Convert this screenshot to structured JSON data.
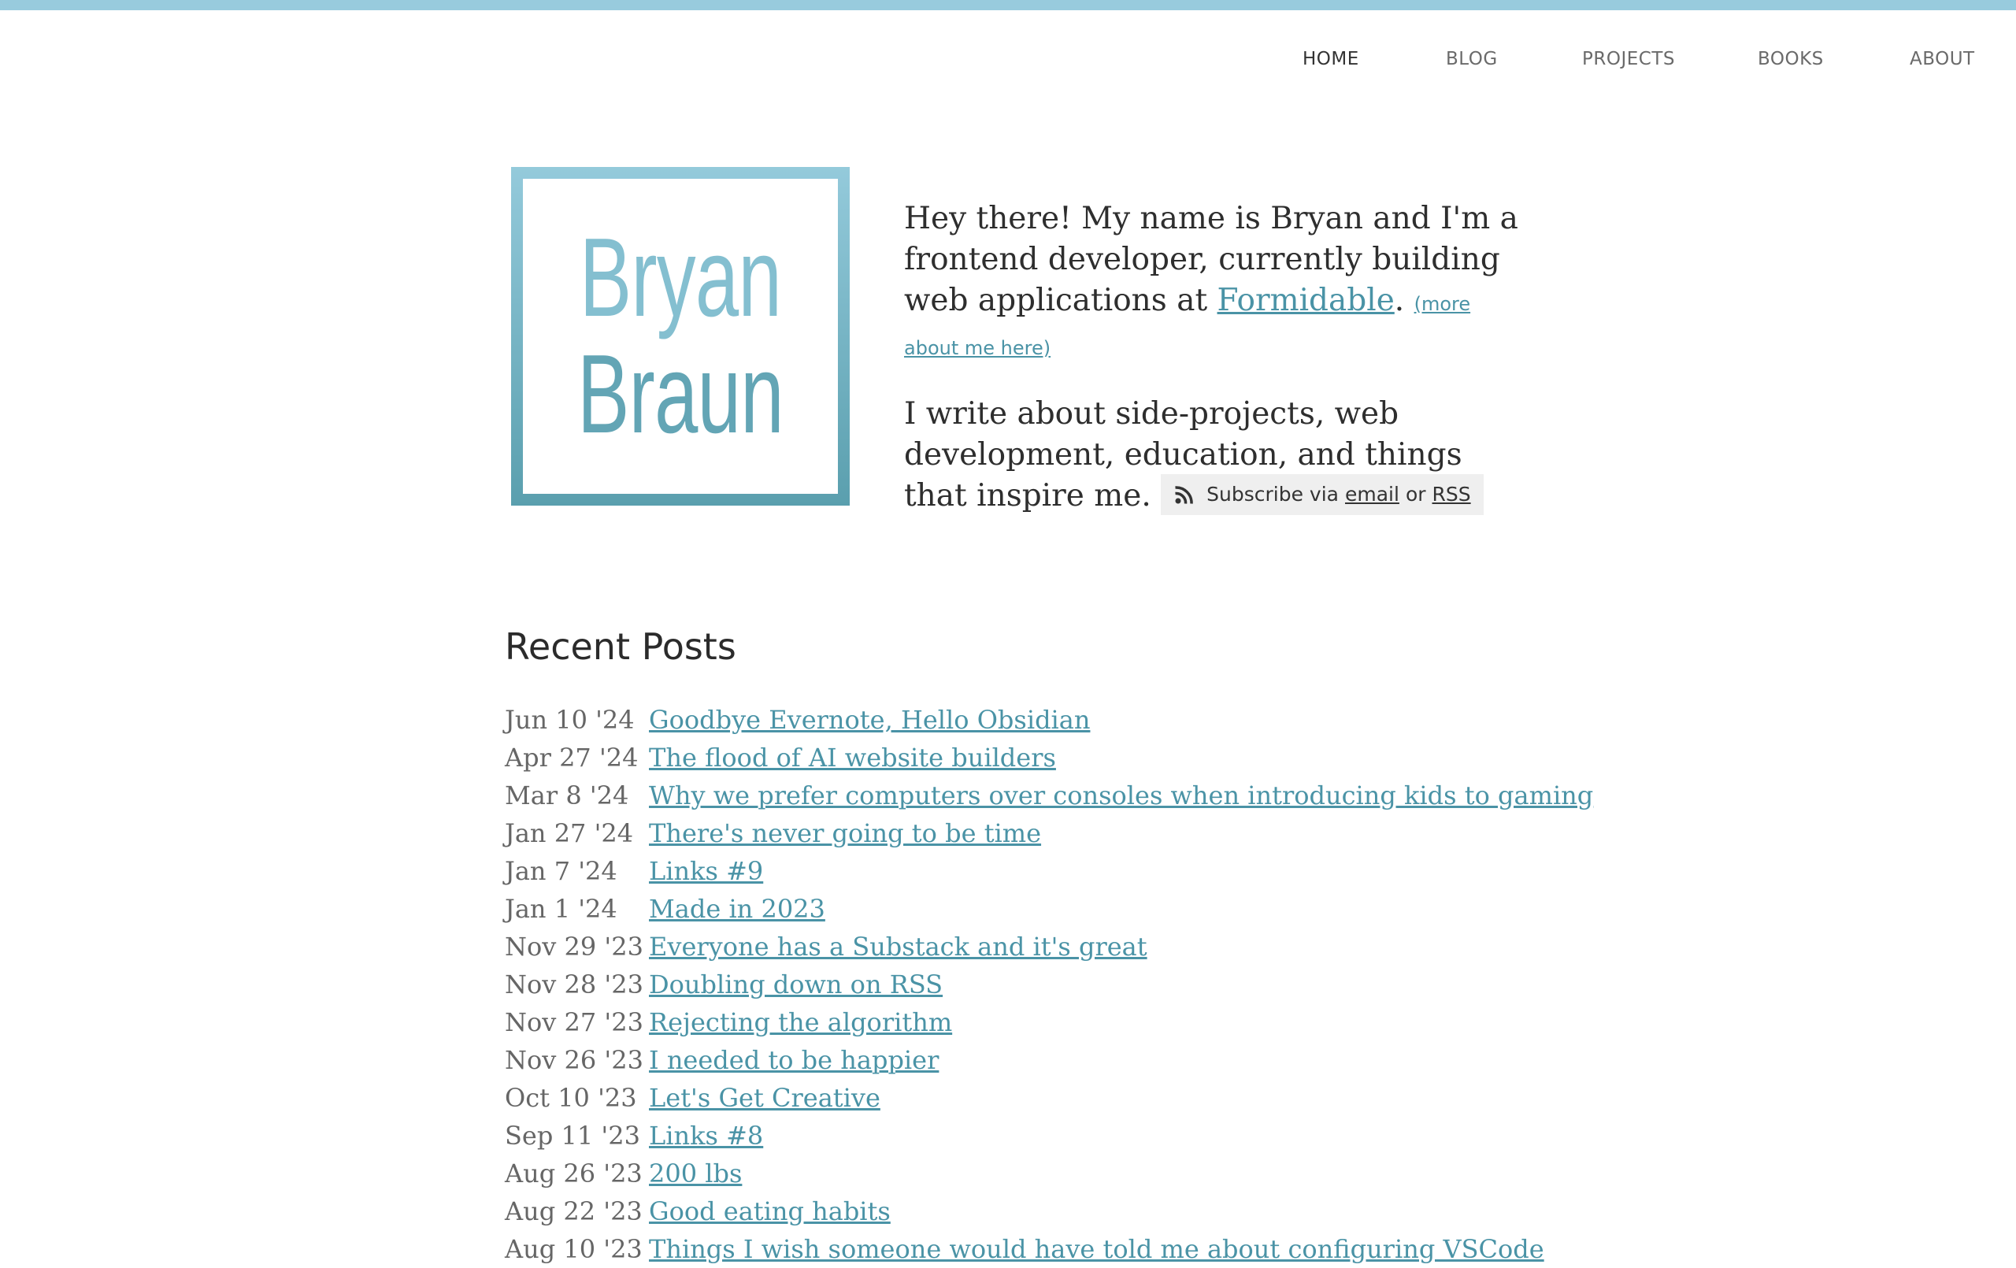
{
  "colors": {
    "accent": "#98cbdd",
    "link": "#4a93a6",
    "subscribe_bg": "#efefef"
  },
  "nav": {
    "items": [
      {
        "label": "HOME",
        "active": true
      },
      {
        "label": "BLOG"
      },
      {
        "label": "PROJECTS"
      },
      {
        "label": "BOOKS"
      },
      {
        "label": "ABOUT"
      }
    ]
  },
  "logo": {
    "line1": "Bryan",
    "line2": "Braun"
  },
  "intro": {
    "p1_text": "Hey there! My name is Bryan and I'm a frontend developer, currently building web applications at ",
    "company_link": "Formidable",
    "p1_after": ".",
    "more_link": "(more about me here)",
    "p2_text": "I write about side-projects, web development, education, and things that inspire me.",
    "subscribe": {
      "icon": "rss-icon",
      "label": "Subscribe via",
      "email": "email",
      "or": "or",
      "rss": "RSS"
    }
  },
  "recent": {
    "heading": "Recent Posts",
    "posts": [
      {
        "date": "Jun 10 '24",
        "title": "Goodbye Evernote, Hello Obsidian"
      },
      {
        "date": "Apr 27 '24",
        "title": "The flood of AI website builders"
      },
      {
        "date": "Mar 8 '24",
        "title": "Why we prefer computers over consoles when introducing kids to gaming"
      },
      {
        "date": "Jan 27 '24",
        "title": "There's never going to be time"
      },
      {
        "date": "Jan 7 '24",
        "title": "Links #9"
      },
      {
        "date": "Jan 1 '24",
        "title": "Made in 2023"
      },
      {
        "date": "Nov 29 '23",
        "title": "Everyone has a Substack and it's great"
      },
      {
        "date": "Nov 28 '23",
        "title": "Doubling down on RSS"
      },
      {
        "date": "Nov 27 '23",
        "title": "Rejecting the algorithm"
      },
      {
        "date": "Nov 26 '23",
        "title": "I needed to be happier"
      },
      {
        "date": "Oct 10 '23",
        "title": "Let's Get Creative"
      },
      {
        "date": "Sep 11 '23",
        "title": "Links #8"
      },
      {
        "date": "Aug 26 '23",
        "title": "200 lbs"
      },
      {
        "date": "Aug 22 '23",
        "title": "Good eating habits"
      },
      {
        "date": "Aug 10 '23",
        "title": "Things I wish someone would have told me about configuring VSCode"
      }
    ]
  }
}
